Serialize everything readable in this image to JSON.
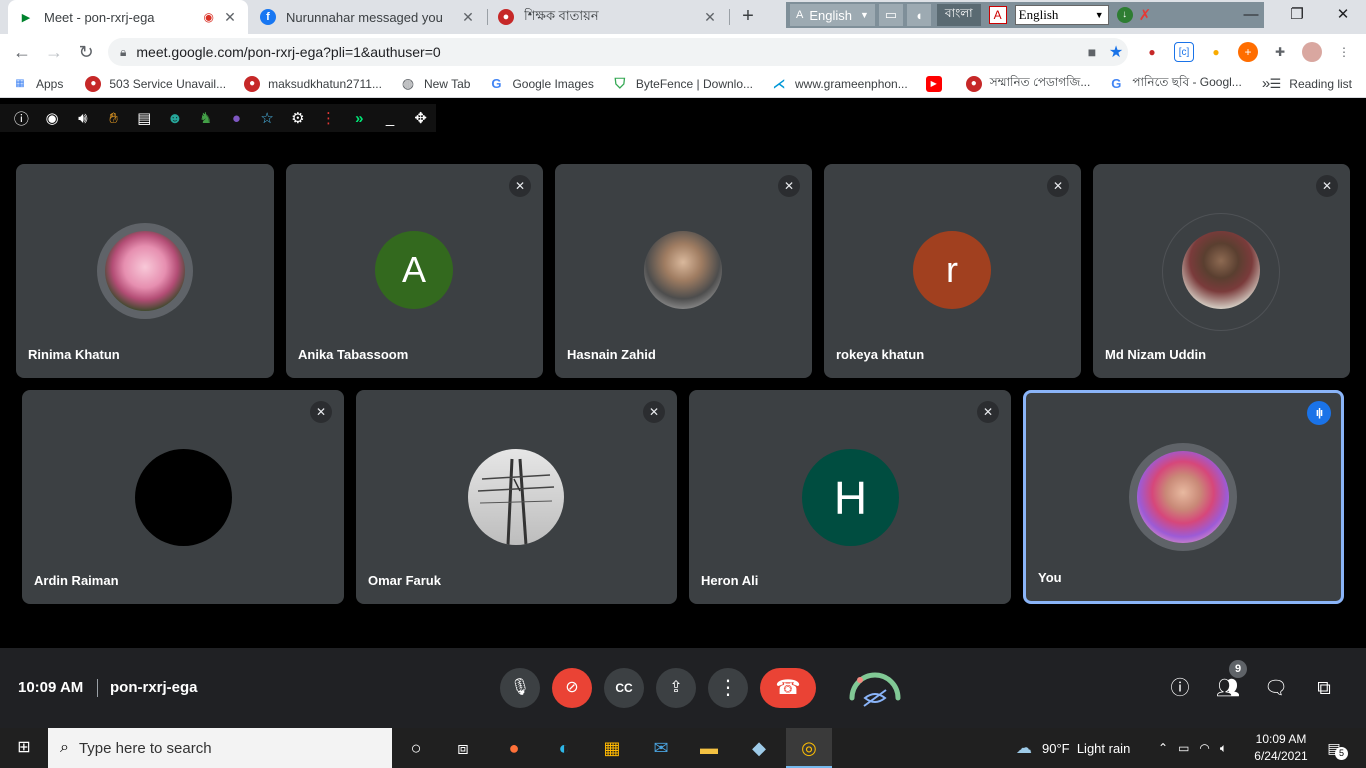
{
  "browser": {
    "tabs": [
      {
        "title": "Meet - pon-rxrj-ega",
        "active": true
      },
      {
        "title": "Nurunnahar messaged you",
        "active": false
      },
      {
        "title": "শিক্ষক বাতায়ন",
        "active": false
      }
    ],
    "lang_toolbar": {
      "input_lang": "English",
      "bangla_label": "বাংলা",
      "select_value": "English"
    },
    "url": "meet.google.com/pon-rxrj-ega?pli=1&authuser=0",
    "bookmarks": [
      {
        "label": "Apps"
      },
      {
        "label": "503 Service Unavail..."
      },
      {
        "label": "maksudkhatun2711..."
      },
      {
        "label": "New Tab"
      },
      {
        "label": "Google Images"
      },
      {
        "label": "ByteFence | Downlo..."
      },
      {
        "label": "www.grameenphon..."
      },
      {
        "label": "সম্মানিত পেডাগজি..."
      },
      {
        "label": "পানিতে ছবি - Googl..."
      }
    ],
    "more_bookmarks": "»",
    "reading_list": "Reading list"
  },
  "participants": [
    {
      "name": "Rinima Khatun",
      "initial": "",
      "muted": false
    },
    {
      "name": "Anika Tabassoom",
      "initial": "A",
      "muted": true,
      "color": "#33691e"
    },
    {
      "name": "Hasnain Zahid",
      "initial": "",
      "muted": true
    },
    {
      "name": "rokeya khatun",
      "initial": "r",
      "muted": true,
      "color": "#a1401f"
    },
    {
      "name": "Md Nizam Uddin",
      "initial": "",
      "muted": true
    },
    {
      "name": "Ardin Raiman",
      "initial": "",
      "muted": true
    },
    {
      "name": "Omar Faruk",
      "initial": "",
      "muted": true
    },
    {
      "name": "Heron Ali",
      "initial": "H",
      "muted": true,
      "color": "#004d40"
    },
    {
      "name": "You",
      "initial": "",
      "muted": false,
      "speaking": true
    }
  ],
  "meeting": {
    "time": "10:09 AM",
    "code": "pon-rxrj-ega",
    "people_count": "9"
  },
  "taskbar": {
    "search_placeholder": "Type here to search",
    "weather": "90°F  Light rain",
    "clock_time": "10:09 AM",
    "clock_date": "6/24/2021",
    "notifications": "5"
  },
  "colors": {
    "tile_bg": "#3c4043",
    "meet_bar": "#202124",
    "end_call": "#ea4335",
    "speaking_border": "#8ab4f8"
  }
}
